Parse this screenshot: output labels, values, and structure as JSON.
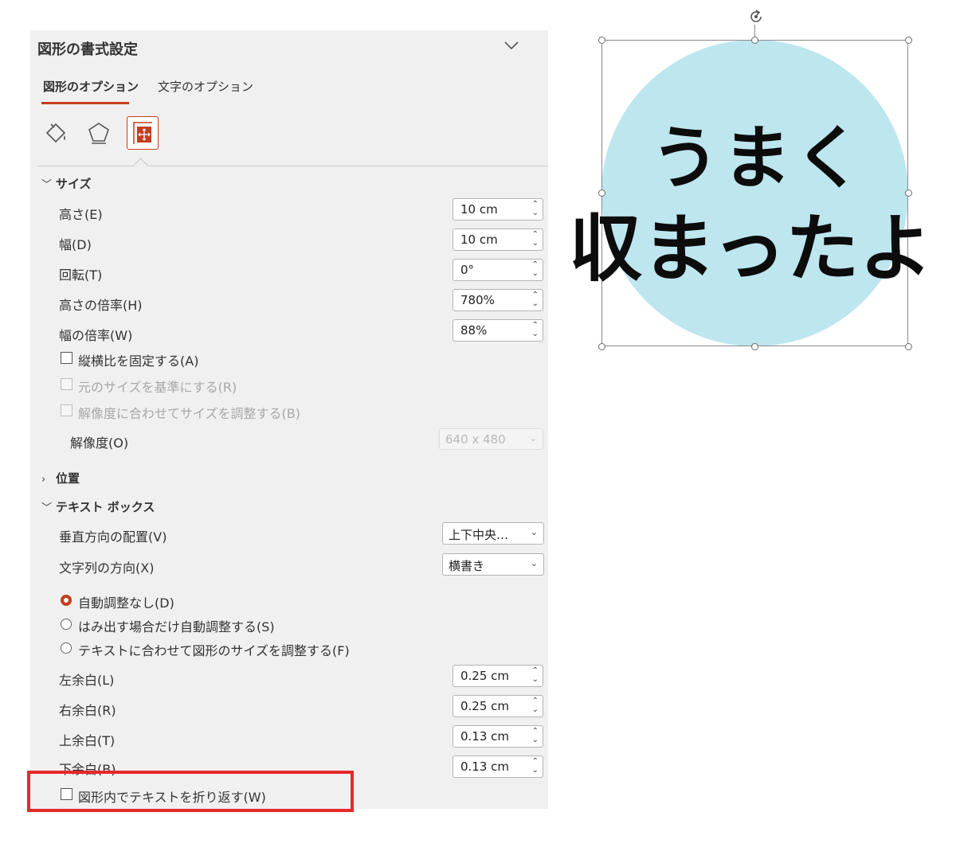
{
  "panel": {
    "title": "図形の書式設定",
    "tabs": [
      {
        "label": "図形のオプション",
        "active": true
      },
      {
        "label": "文字のオプション",
        "active": false
      }
    ],
    "icons": [
      "fill-line-icon",
      "effects-icon",
      "size-properties-icon"
    ],
    "accent_color": "#c43e1c"
  },
  "size_section": {
    "title": "サイズ",
    "height_label": "高さ(E)",
    "height_value": "10 cm",
    "width_label": "幅(D)",
    "width_value": "10 cm",
    "rotation_label": "回転(T)",
    "rotation_value": "0°",
    "scale_height_label": "高さの倍率(H)",
    "scale_height_value": "780%",
    "scale_width_label": "幅の倍率(W)",
    "scale_width_value": "88%",
    "lock_aspect_label": "縦横比を固定する(A)",
    "relative_original_label": "元のサイズを基準にする(R)",
    "best_scale_label": "解像度に合わせてサイズを調整する(B)",
    "resolution_label": "解像度(O)",
    "resolution_value": "640 x 480"
  },
  "position_section": {
    "title": "位置"
  },
  "textbox_section": {
    "title": "テキスト ボックス",
    "vertical_align_label": "垂直方向の配置(V)",
    "vertical_align_value": "上下中央…",
    "text_direction_label": "文字列の方向(X)",
    "text_direction_value": "横書き",
    "autofit_options": [
      {
        "label": "自動調整なし(D)",
        "selected": true
      },
      {
        "label": "はみ出す場合だけ自動調整する(S)",
        "selected": false
      },
      {
        "label": "テキストに合わせて図形のサイズを調整する(F)",
        "selected": false
      }
    ],
    "left_margin_label": "左余白(L)",
    "left_margin_value": "0.25 cm",
    "right_margin_label": "右余白(R)",
    "right_margin_value": "0.25 cm",
    "top_margin_label": "上余白(T)",
    "top_margin_value": "0.13 cm",
    "bottom_margin_label": "下余白(B)",
    "bottom_margin_value": "0.13 cm",
    "wrap_text_label": "図形内でテキストを折り返す(W)"
  },
  "highlight_color": "#e8272a",
  "canvas": {
    "shape_fill": "#bde6ef",
    "line1": "うまく",
    "line2": "収まったよ"
  }
}
